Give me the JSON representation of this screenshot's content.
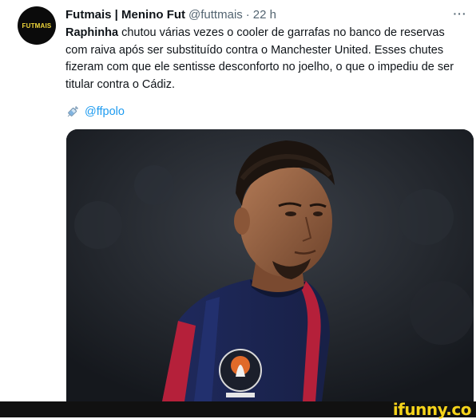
{
  "tweet": {
    "avatar_text": "FUTMAIS",
    "display_name": "Futmais | Menino Fut",
    "handle": "@futtmais",
    "separator": "·",
    "time": "22 h",
    "more_label": "···",
    "body_bold": "Raphinha",
    "body_text": " chutou várias vezes o cooler de garrafas no banco de reservas com raiva após ser substituído contra o Manchester United. Esses chutes fizeram com que ele sentisse desconforto no joelho, o que o impediu de ser titular contra o Cádiz.",
    "link_icon": "syringe-icon",
    "link_text": "@ffpolo",
    "media_description_icon": "photo"
  },
  "footer": {
    "watermark": "ifunny.co"
  },
  "colors": {
    "link": "#1d9bf0",
    "muted": "#536471",
    "watermark": "#f5d31a"
  }
}
